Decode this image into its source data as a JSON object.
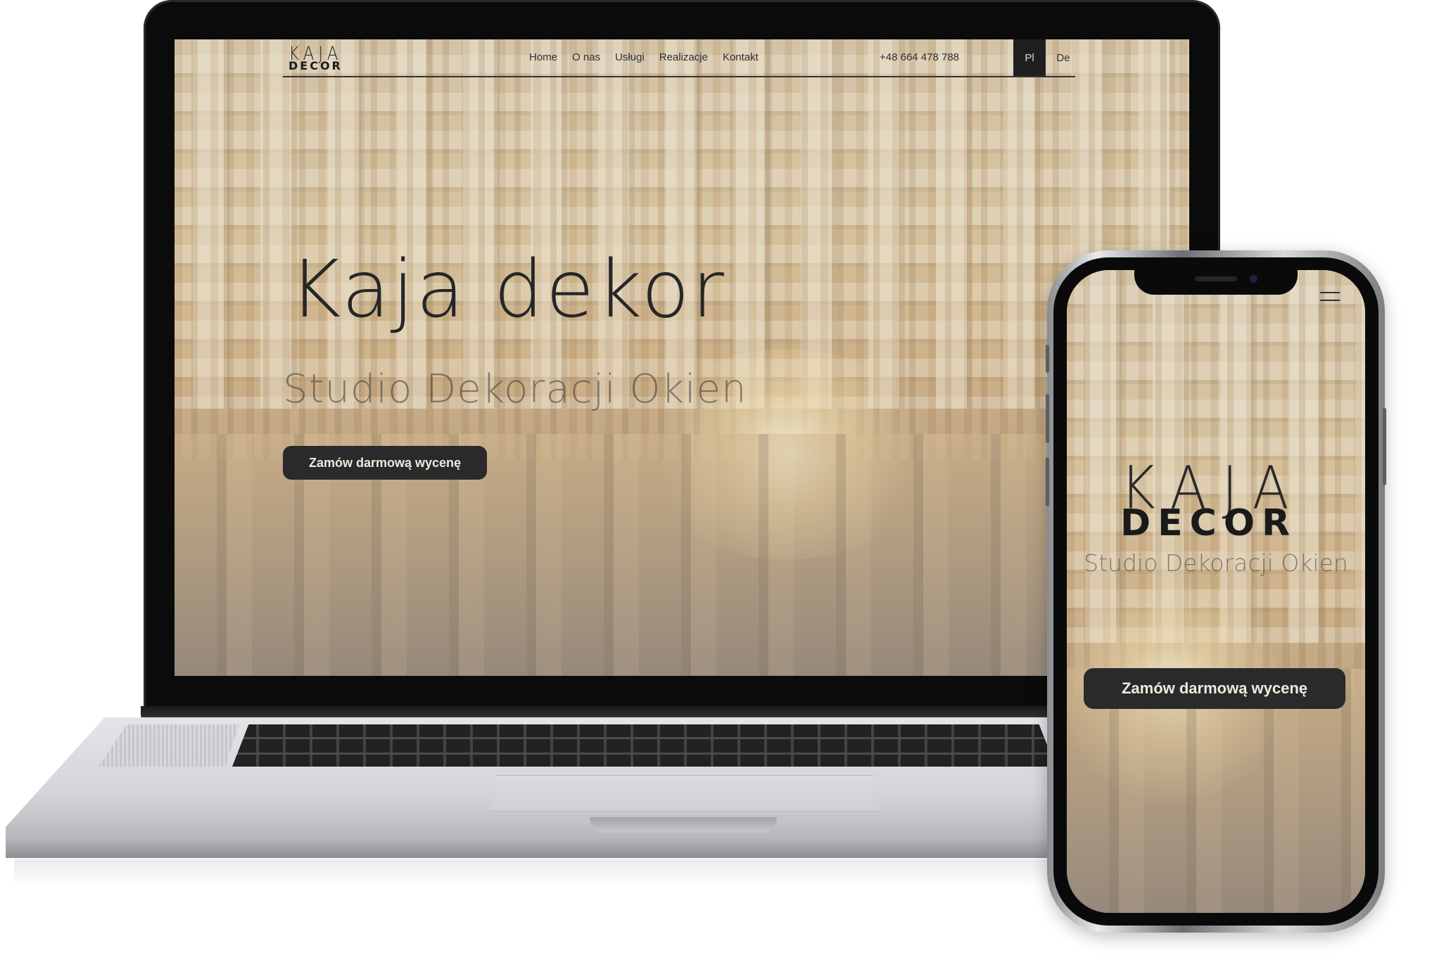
{
  "site": {
    "logo_top": "KAJA",
    "logo_bottom": "DECOR",
    "nav": [
      "Home",
      "O nas",
      "Usługi",
      "Realizacje",
      "Kontakt"
    ],
    "phone": "+48 664 478 788",
    "languages": [
      "Pl",
      "De"
    ],
    "active_language": "Pl",
    "hero_title": "Kaja dekor",
    "hero_subtitle": "Studio Dekoracji Okien",
    "cta": "Zamów darmową wycenę"
  },
  "mobile": {
    "logo_top": "KAJA",
    "logo_bottom": "DECOR",
    "subtitle": "Studio Dekoracji Okien",
    "cta": "Zamów darmową wycenę",
    "menu_icon": "hamburger-menu-icon"
  },
  "colors": {
    "button_bg": "#2a2a2a",
    "button_text": "#f0e8dc",
    "photo_tone": "#c7a06a"
  }
}
